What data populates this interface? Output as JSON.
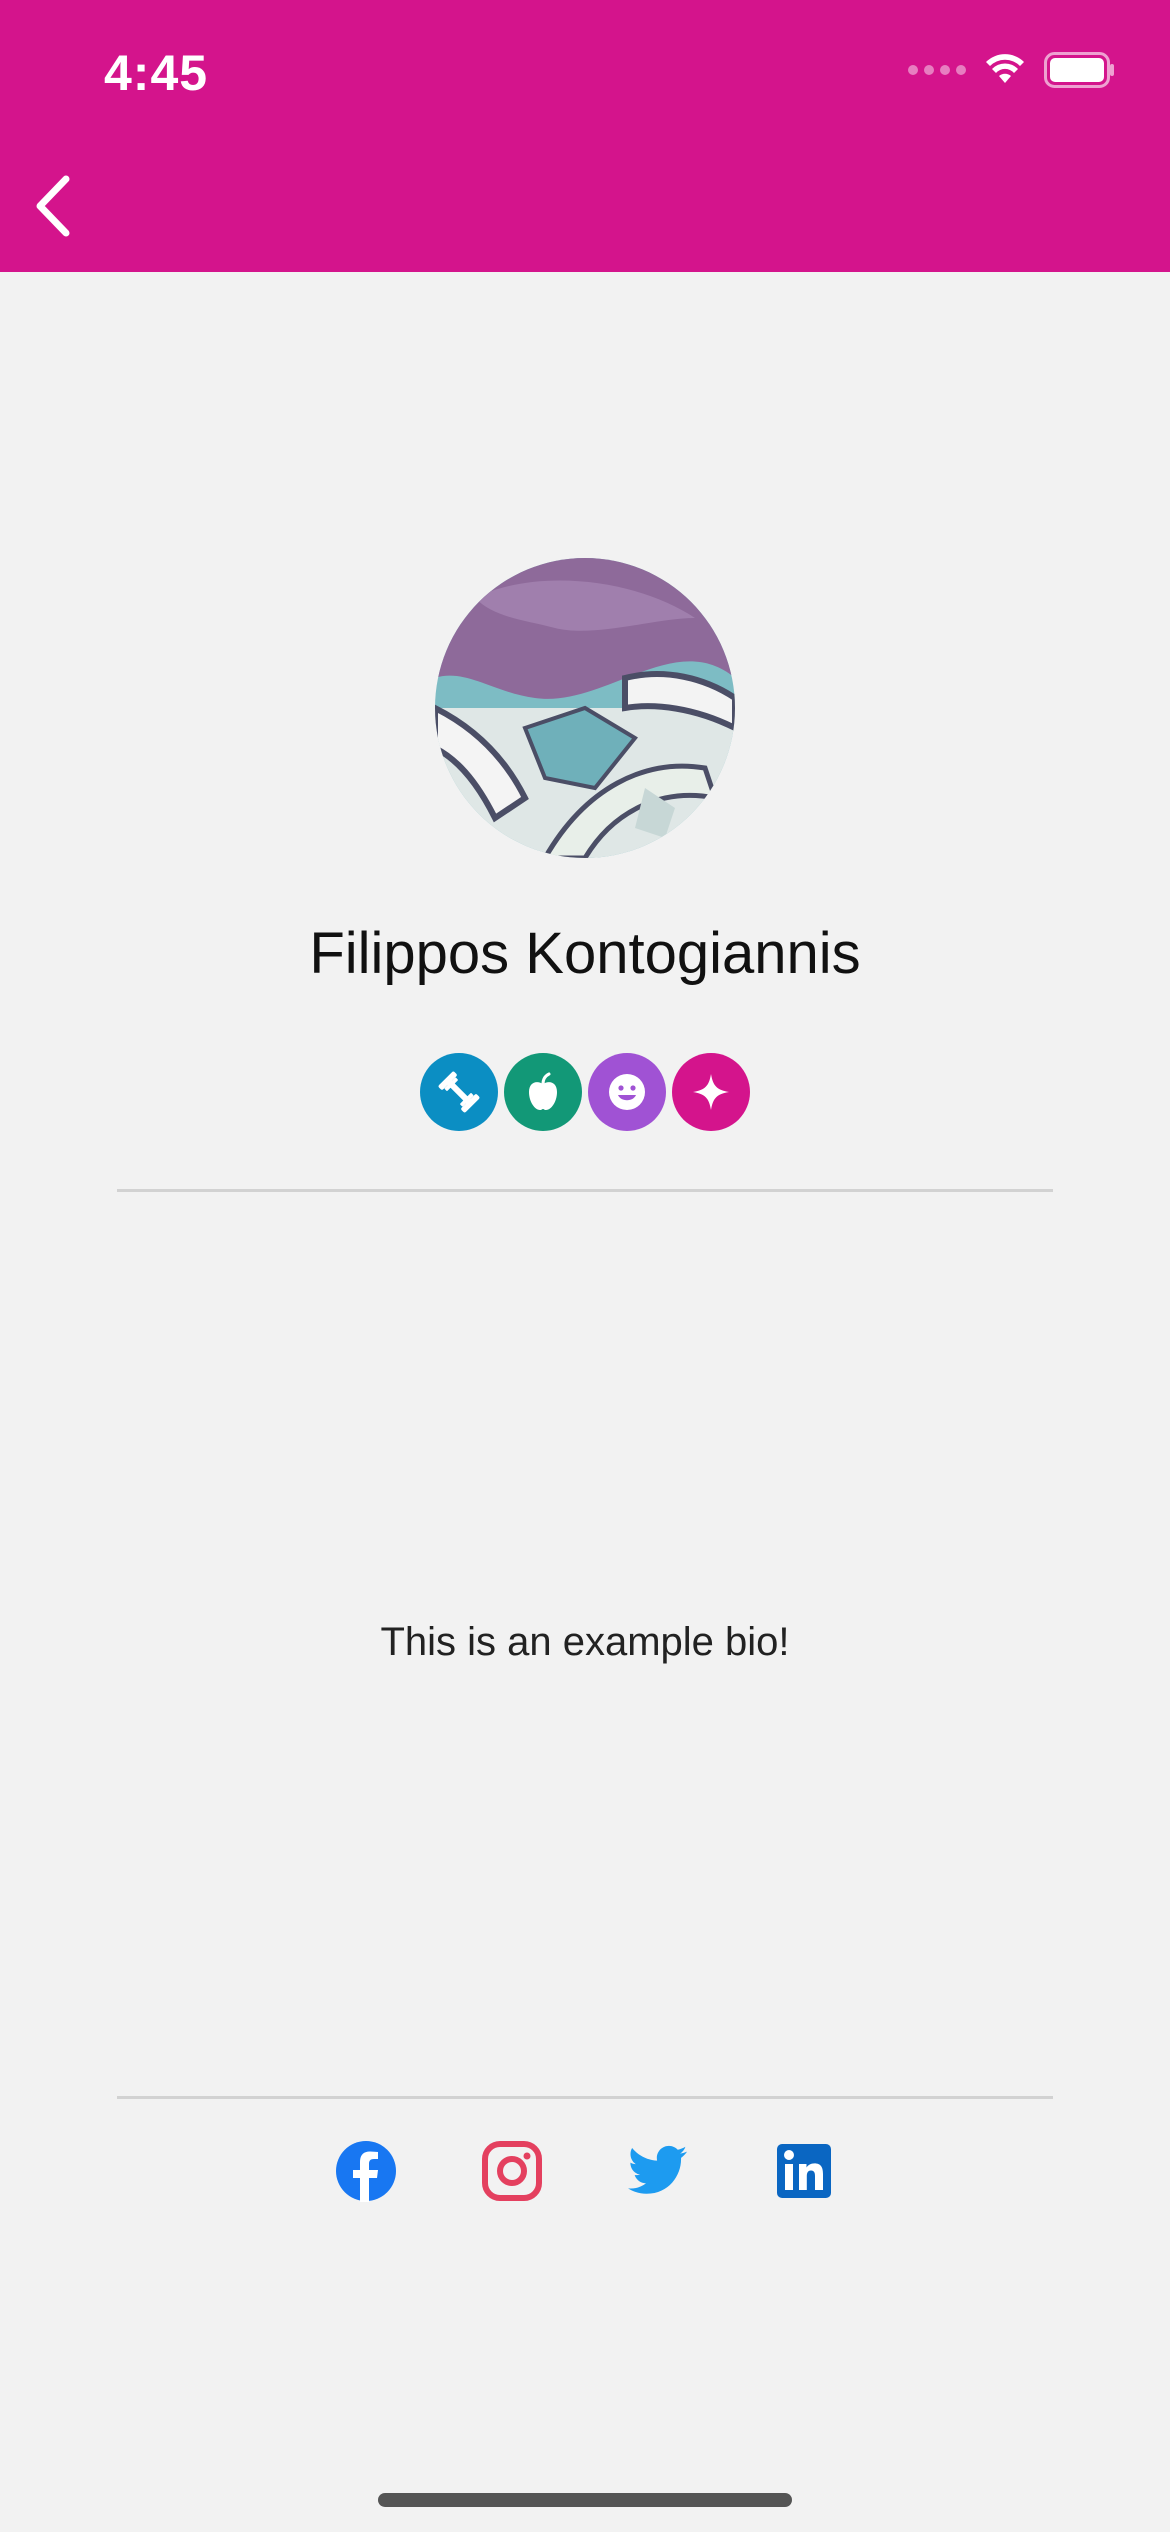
{
  "status_bar": {
    "time": "4:45"
  },
  "header": {
    "background_color": "#d4148c",
    "back_icon": "chevron-left-icon"
  },
  "profile": {
    "name": "Filippos Kontogiannis",
    "avatar_icon": "profile-avatar",
    "badges": [
      {
        "name": "fitness-badge",
        "icon": "dumbbell-icon",
        "color": "#0b8ec3"
      },
      {
        "name": "nutrition-badge",
        "icon": "apple-icon",
        "color": "#129877"
      },
      {
        "name": "mood-badge",
        "icon": "smiley-icon",
        "color": "#a052d4"
      },
      {
        "name": "special-badge",
        "icon": "sparkle-icon",
        "color": "#d4148c"
      }
    ],
    "bio": "This is an example bio!"
  },
  "socials": [
    {
      "name": "facebook",
      "icon": "facebook-icon",
      "color": "#1877f2"
    },
    {
      "name": "instagram",
      "icon": "instagram-icon",
      "color": "#e4405f"
    },
    {
      "name": "twitter",
      "icon": "twitter-icon",
      "color": "#1d9bf0"
    },
    {
      "name": "linkedin",
      "icon": "linkedin-icon",
      "color": "#0a66c2"
    }
  ]
}
